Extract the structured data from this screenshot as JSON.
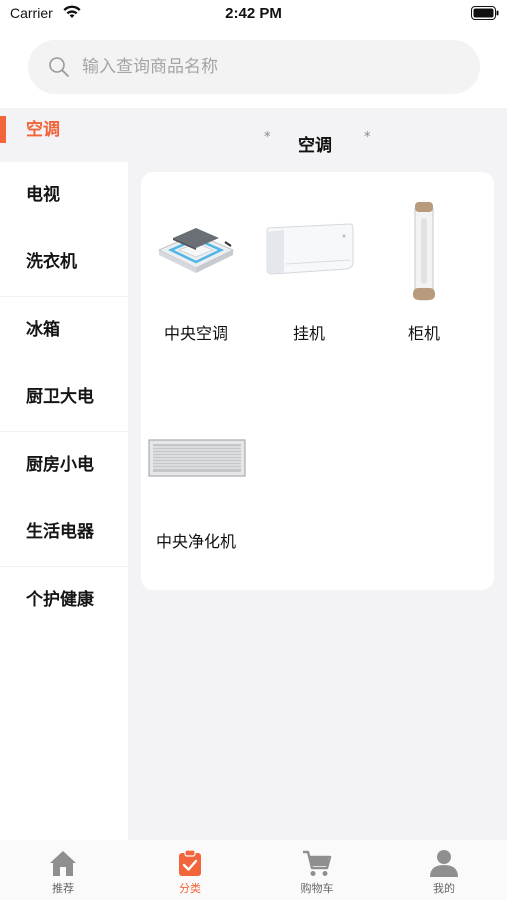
{
  "status": {
    "carrier": "Carrier",
    "time": "2:42 PM"
  },
  "search": {
    "placeholder": "输入查询商品名称"
  },
  "sidebar": {
    "items": [
      {
        "label": "空调",
        "active": true
      },
      {
        "label": "电视"
      },
      {
        "label": "洗衣机"
      },
      {
        "label": "冰箱"
      },
      {
        "label": "厨卫大电"
      },
      {
        "label": "厨房小电"
      },
      {
        "label": "生活电器"
      },
      {
        "label": "个护健康"
      }
    ]
  },
  "section": {
    "title": "空调"
  },
  "products": [
    {
      "name": "中央空调",
      "icon": "ceiling-cassette-ac-image"
    },
    {
      "name": "挂机",
      "icon": "wall-mounted-ac-image"
    },
    {
      "name": "柜机",
      "icon": "floor-standing-ac-image"
    },
    {
      "name": "中央净化机",
      "icon": "central-purifier-image"
    }
  ],
  "tabbar": {
    "tabs": [
      {
        "label": "推荐",
        "icon": "home-icon"
      },
      {
        "label": "分类",
        "icon": "category-icon",
        "active": true
      },
      {
        "label": "购物车",
        "icon": "cart-icon"
      },
      {
        "label": "我的",
        "icon": "user-icon"
      }
    ]
  },
  "colors": {
    "accent": "#f2643a",
    "background": "#f3f3f6",
    "card": "#ffffff"
  }
}
